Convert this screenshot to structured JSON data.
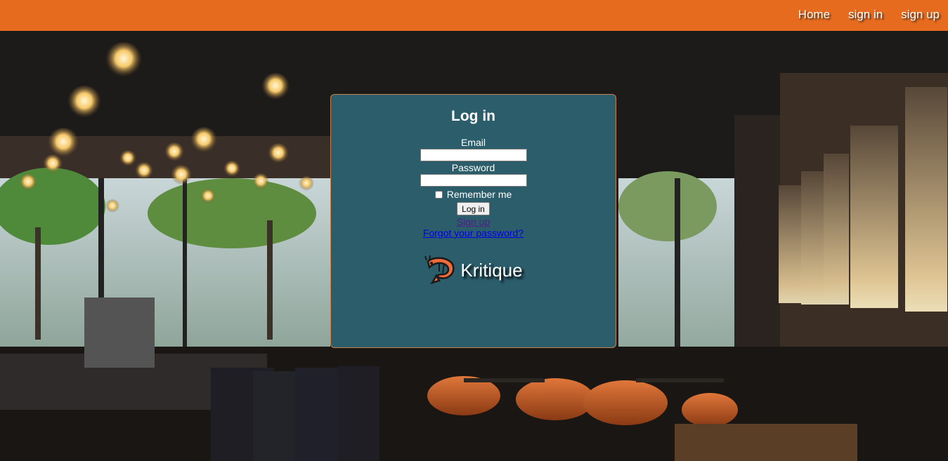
{
  "nav": {
    "links": [
      "Home",
      "sign in",
      "sign up"
    ]
  },
  "login": {
    "title": "Log in",
    "email_label": "Email",
    "password_label": "Password",
    "remember_label": "Remember me",
    "submit_label": "Log in",
    "signup_link": "Sign up",
    "forgot_link": "Forgot your password?"
  },
  "brand": {
    "name": "Kritique",
    "logo_icon": "shrimp-icon"
  },
  "colors": {
    "navbar": "#e76b1f",
    "card": "#2b5d6b",
    "card_border": "#c7824a",
    "visited_link": "#551a8b",
    "link": "#0000ee"
  }
}
